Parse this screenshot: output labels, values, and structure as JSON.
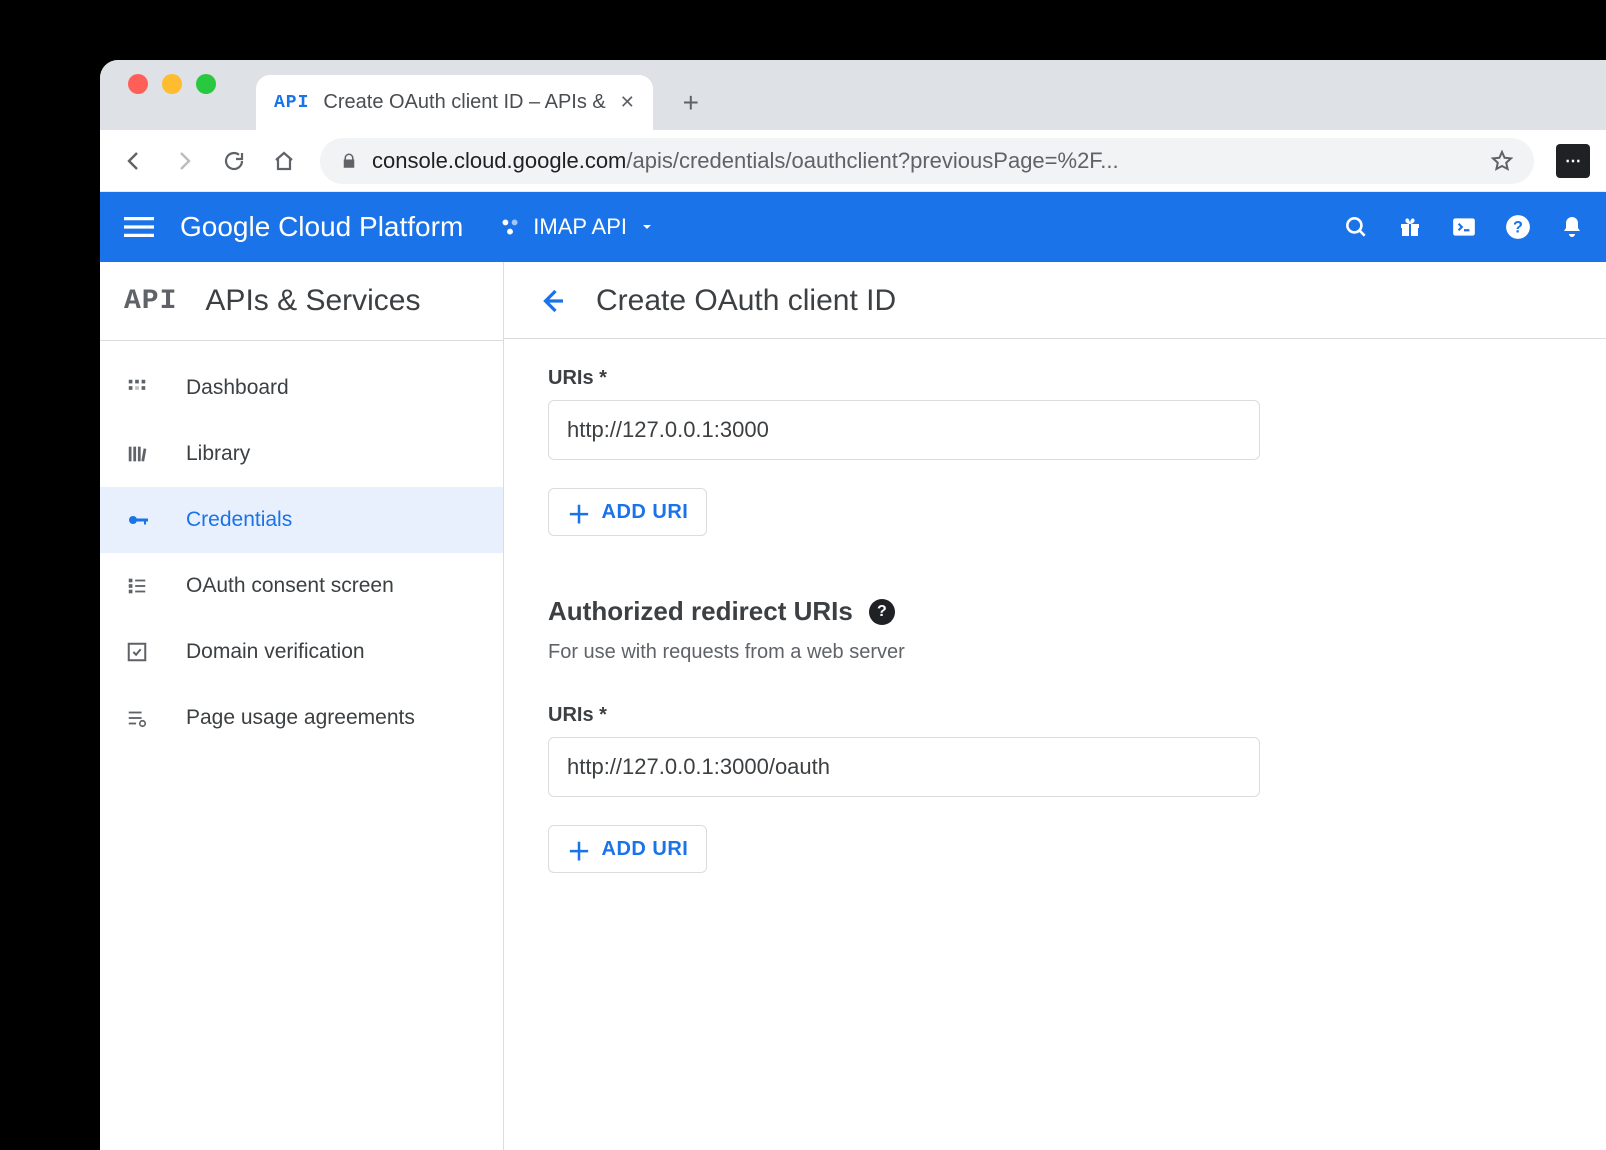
{
  "browser": {
    "tab_favicon": "API",
    "tab_title": "Create OAuth client ID – APIs &",
    "url_host": "console.cloud.google.com",
    "url_path": "/apis/credentials/oauthclient?previousPage=%2F..."
  },
  "gcp": {
    "logo_google": "Google",
    "logo_rest": " Cloud Platform",
    "project_name": "IMAP API"
  },
  "sidebar": {
    "badge": "API",
    "title": "APIs & Services",
    "items": [
      {
        "label": "Dashboard"
      },
      {
        "label": "Library"
      },
      {
        "label": "Credentials"
      },
      {
        "label": "OAuth consent screen"
      },
      {
        "label": "Domain verification"
      },
      {
        "label": "Page usage agreements"
      }
    ]
  },
  "main": {
    "title": "Create OAuth client ID",
    "section1": {
      "label": "URIs *",
      "value": "http://127.0.0.1:3000",
      "add_label": "ADD URI"
    },
    "section2": {
      "heading": "Authorized redirect URIs",
      "subtext": "For use with requests from a web server",
      "label": "URIs *",
      "value": "http://127.0.0.1:3000/oauth",
      "add_label": "ADD URI"
    }
  }
}
